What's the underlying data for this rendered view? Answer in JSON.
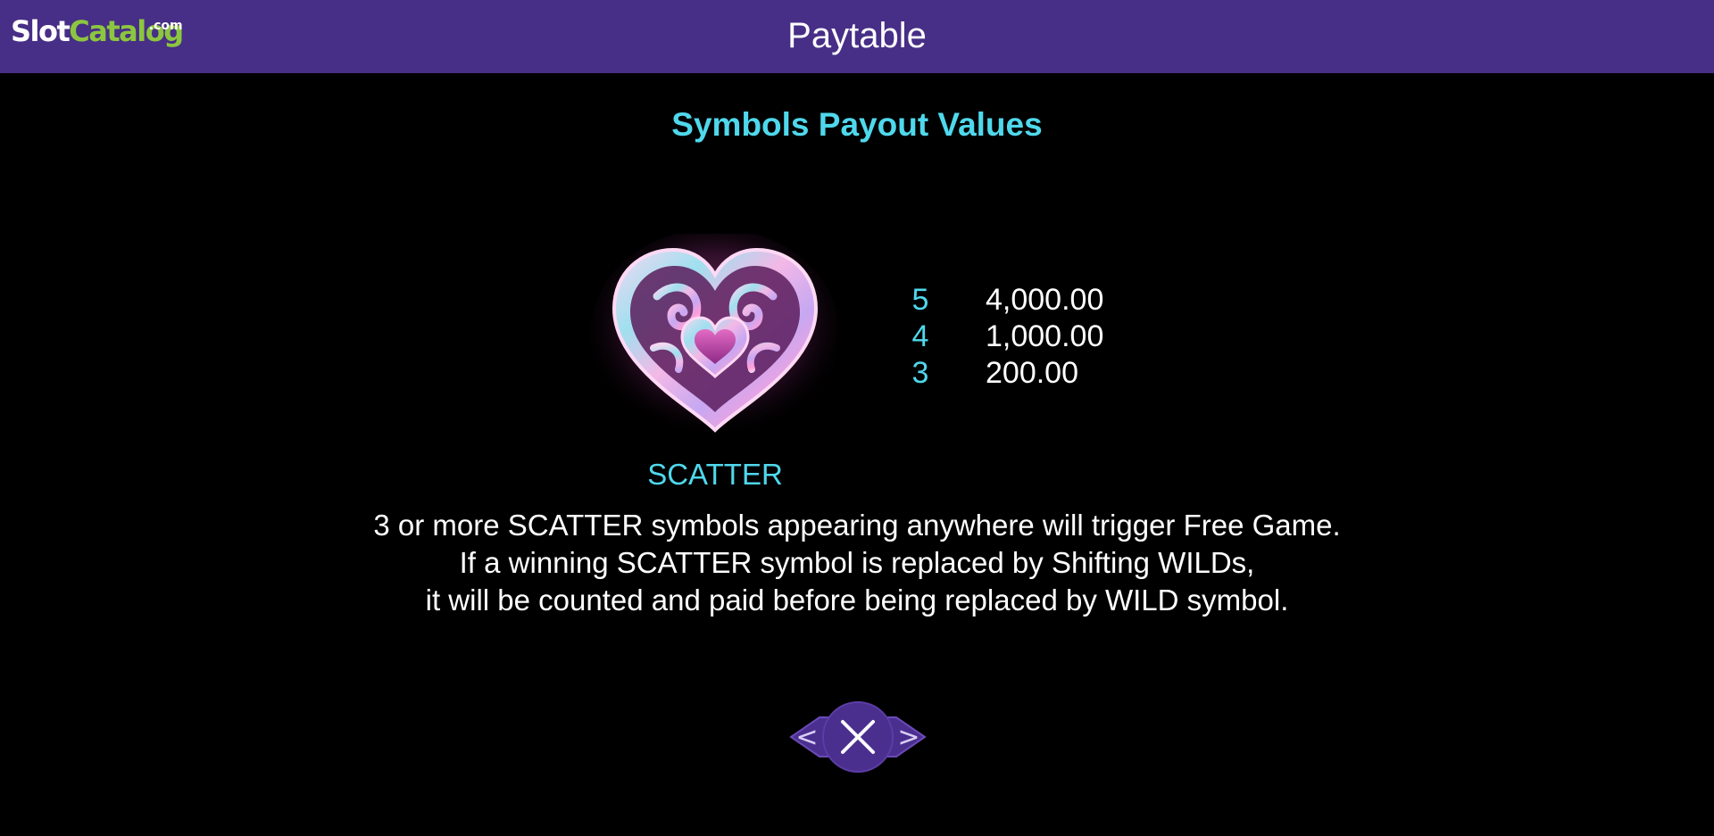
{
  "header": {
    "logo": {
      "slot": "Slot",
      "catalog": "Catalog",
      "com": ".com"
    },
    "title": "Paytable"
  },
  "section_title": "Symbols Payout Values",
  "symbol": {
    "icon": "heart-scatter-icon",
    "name": "SCATTER",
    "payouts": [
      {
        "count": "5",
        "value": "4,000.00"
      },
      {
        "count": "4",
        "value": "1,000.00"
      },
      {
        "count": "3",
        "value": "200.00"
      }
    ]
  },
  "description": [
    "3 or more SCATTER symbols appearing anywhere will trigger Free Game.",
    "If a winning SCATTER symbol is replaced by Shifting WILDs,",
    "it will be counted and paid before being replaced by WILD symbol."
  ],
  "navigation": {
    "prev_label": "<",
    "next_label": ">",
    "close_icon": "close-icon"
  },
  "colors": {
    "header_bg": "#472e86",
    "accent": "#4fd8ec",
    "nav_bg": "#4a2f8f",
    "logo_green": "#8cc63f"
  }
}
